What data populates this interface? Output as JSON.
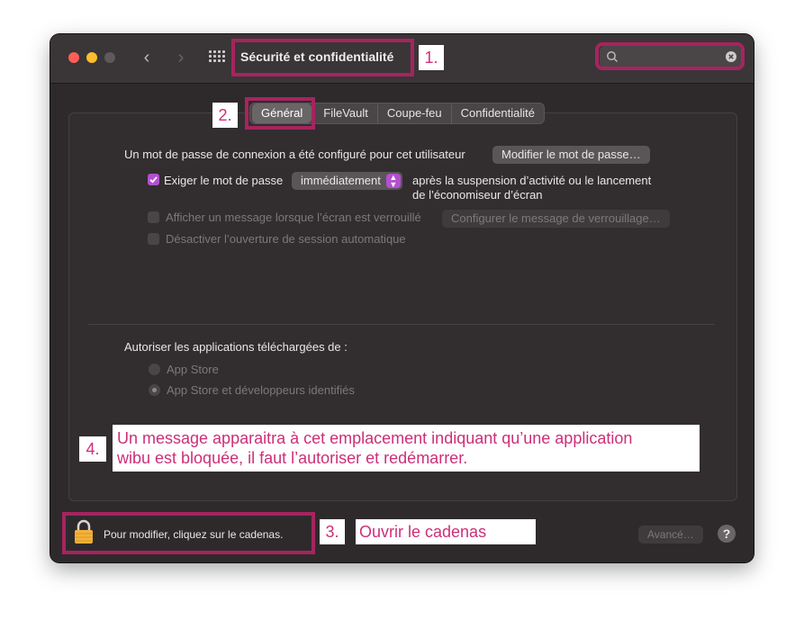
{
  "window": {
    "title": "Sécurité et confidentialité"
  },
  "tabs": [
    "Général",
    "FileVault",
    "Coupe-feu",
    "Confidentialité"
  ],
  "general": {
    "password_text": "Un mot de passe de connexion a été configuré pour cet utilisateur",
    "change_password_button": "Modifier le mot de passe…",
    "require_password_label": "Exiger le mot de passe",
    "require_password_value": "immédiatement",
    "after_text_line1": "après la suspension d’activité ou le lancement",
    "after_text_line2": "de l’économiseur d’écran",
    "show_message_label": "Afficher un message lorsque l’écran est verrouillé",
    "set_lock_message_button": "Configurer le message de verrouillage…",
    "disable_autologin_label": "Désactiver l’ouverture de session automatique",
    "allow_apps_label": "Autoriser les applications téléchargées de :",
    "radio_app_store": "App Store",
    "radio_app_store_devs": "App Store et développeurs identifiés"
  },
  "footer": {
    "lock_text": "Pour modifier, cliquez sur le cadenas.",
    "advanced_button": "Avancé…",
    "help_button": "?"
  },
  "annotations": {
    "n1": "1.",
    "n2": "2.",
    "n3": "3.",
    "n3_text": "Ouvrir le cadenas",
    "n4": "4.",
    "n4_line1": "Un message apparaitra à cet emplacement indiquant qu’une application",
    "n4_line2": "wibu est bloquée, il faut l’autoriser et redémarrer."
  },
  "colors": {
    "highlight": "#a6245f",
    "annotation_text": "#cc2f79",
    "checkbox_checked": "#b44fd1"
  }
}
